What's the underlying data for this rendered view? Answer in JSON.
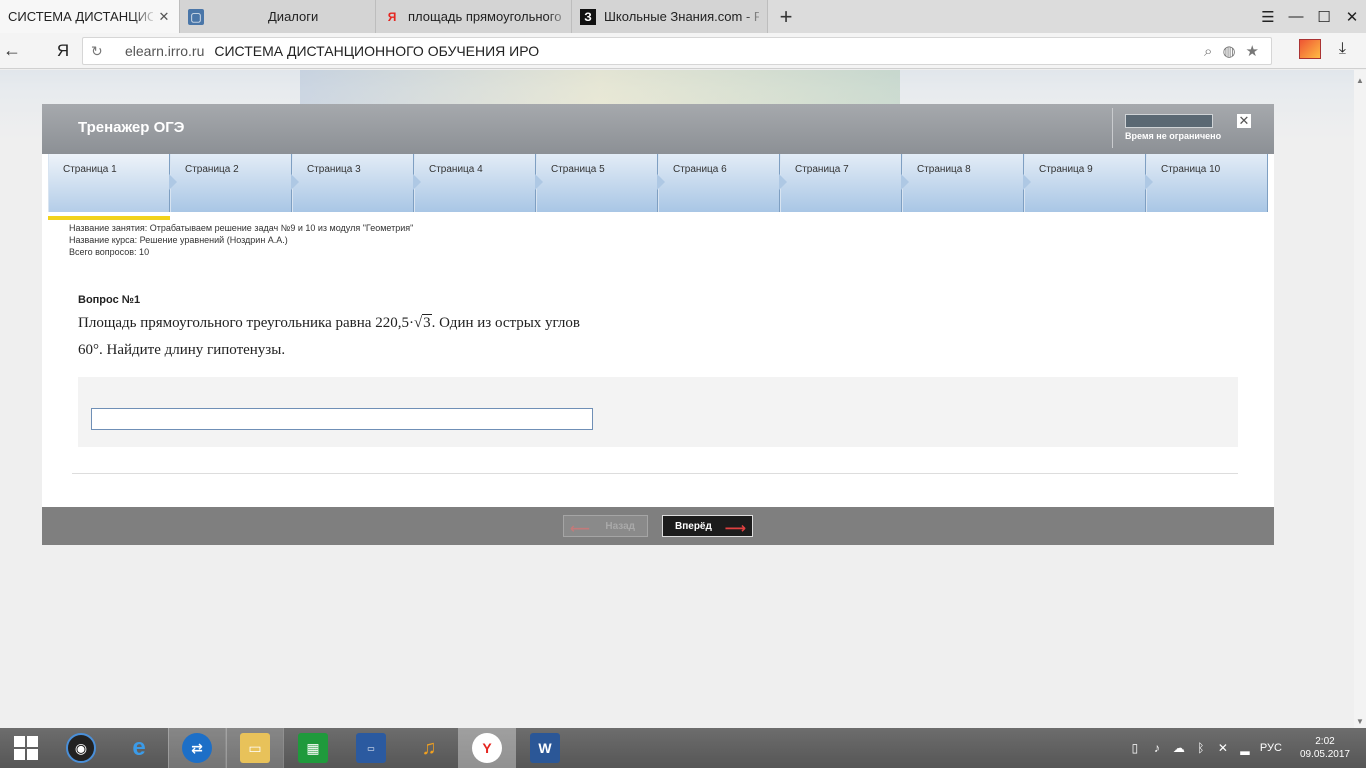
{
  "browser": {
    "tabs": [
      {
        "title": "СИСТЕМА ДИСТАНЦИОННОГО ОБУЧЕНИЯ ИРО",
        "icon": "page-icon",
        "active": true
      },
      {
        "title": "Диалоги",
        "icon": "chat-icon",
        "active": false
      },
      {
        "title": "площадь прямоугольного треугольника",
        "icon": "yandex-icon",
        "active": false
      },
      {
        "title": "Школьные Знания.com - Решение",
        "icon": "znanija-icon",
        "active": false
      }
    ],
    "new_tab": "+",
    "back": "←",
    "yandex_logo": "Я",
    "url_domain": "elearn.irro.ru",
    "url_title": "СИСТЕМА ДИСТАНЦИОННОГО ОБУЧЕНИЯ ИРО"
  },
  "trainer": {
    "title": "Тренажер ОГЭ",
    "timer_label": "Время не ограничено",
    "close": "✕",
    "pages": [
      "Страница 1",
      "Страница 2",
      "Страница 3",
      "Страница 4",
      "Страница 5",
      "Страница 6",
      "Страница 7",
      "Страница 8",
      "Страница 9",
      "Страница 10"
    ],
    "active_page": 1,
    "lesson_name": "Название занятия: Отрабатываем решение задач №9 и 10 из модуля \"Геометрия\"",
    "course_name": "Название курса: Решение уравнений (Ноздрин А.А.)",
    "total_questions": "Всего вопросов: 10",
    "question_number": "Вопрос №1",
    "question_part1": "Площадь прямоугольного треугольника равна 220,5·",
    "question_sqrt": "3",
    "question_part2": ". Один из острых углов",
    "question_angle": "60°",
    "question_part3": ". Найдите длину гипотенузы.",
    "answer_value": "",
    "back_button": "Назад",
    "next_button": "Вперёд"
  },
  "taskbar": {
    "apps": [
      "media-player-icon",
      "internet-explorer-icon",
      "teamviewer-icon",
      "file-explorer-icon",
      "store-icon",
      "lenovo-icon",
      "headphones-icon",
      "yandex-browser-icon",
      "word-icon"
    ],
    "language": "РУС",
    "time": "2:02",
    "date": "09.05.2017"
  }
}
